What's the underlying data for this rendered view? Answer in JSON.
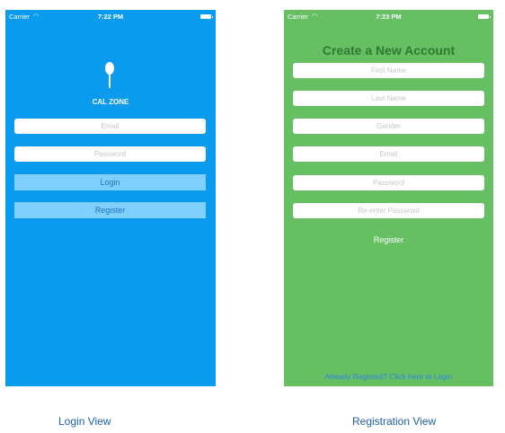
{
  "login": {
    "status": {
      "carrier": "Carrier",
      "time": "7:22 PM"
    },
    "app_name": "CAL ZONE",
    "email_placeholder": "Email",
    "password_placeholder": "Password",
    "login_label": "Login",
    "register_label": "Register",
    "caption": "Login View"
  },
  "register": {
    "status": {
      "carrier": "Carrier",
      "time": "7:23 PM"
    },
    "title": "Create a New Account",
    "fields": [
      "First Name",
      "Last Name",
      "Gender",
      "Email",
      "Password",
      "Re-enter Password"
    ],
    "register_label": "Register",
    "login_link": "Already Registed? Click here to Login",
    "caption": "Registration View"
  },
  "colors": {
    "login_bg": "#0a9bee",
    "register_bg": "#66bf63",
    "button_bg": "#7fd0ff",
    "caption": "#1f5fa8"
  },
  "icons": [
    "wifi-icon",
    "battery-icon",
    "spoon-icon"
  ]
}
